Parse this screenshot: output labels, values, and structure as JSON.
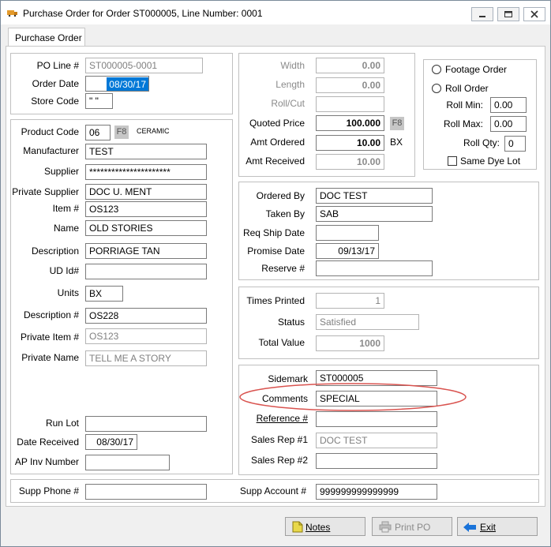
{
  "window": {
    "title": "Purchase Order for Order ST000005, Line Number: 0001"
  },
  "tab": {
    "label": "Purchase Order"
  },
  "header_group": {
    "po_line_label": "PO Line #",
    "po_line_value": "ST000005-0001",
    "order_date_label": "Order Date",
    "order_date_value": "08/30/17",
    "store_code_label": "Store Code",
    "store_code_value": "\" \""
  },
  "product_group": {
    "product_code_label": "Product Code",
    "product_code_value": "06",
    "f8_label": "F8",
    "product_code_desc": "CERAMIC",
    "manufacturer_label": "Manufacturer",
    "manufacturer_value": "TEST",
    "supplier_label": "Supplier",
    "supplier_value": "**********************",
    "private_supplier_label": "Private Supplier",
    "private_supplier_value": "DOC U. MENT",
    "item_label": "Item #",
    "item_value": "OS123",
    "name_label": "Name",
    "name_value": "OLD STORIES",
    "description_label": "Description",
    "description_value": "PORRIAGE TAN",
    "ud_id_label": "UD Id#",
    "ud_id_value": "",
    "units_label": "Units",
    "units_value": "BX",
    "description_no_label": "Description #",
    "description_no_value": "OS228",
    "private_item_label": "Private Item #",
    "private_item_value": "OS123",
    "private_name_label": "Private Name",
    "private_name_value": "TELL ME A STORY",
    "run_lot_label": "Run Lot",
    "run_lot_value": "",
    "date_received_label": "Date Received",
    "date_received_value": "08/30/17",
    "ap_inv_label": "AP Inv Number",
    "ap_inv_value": ""
  },
  "qty_group": {
    "width_label": "Width",
    "width_value": "0.00",
    "length_label": "Length",
    "length_value": "0.00",
    "roll_cut_label": "Roll/Cut",
    "roll_cut_value": "",
    "quoted_price_label": "Quoted Price",
    "quoted_price_value": "100.000",
    "f8_label": "F8",
    "amt_ordered_label": "Amt Ordered",
    "amt_ordered_value": "10.00",
    "amt_ordered_unit": "BX",
    "amt_received_label": "Amt Received",
    "amt_received_value": "10.00"
  },
  "roll_group": {
    "footage_order_label": "Footage Order",
    "roll_order_label": "Roll Order",
    "roll_min_label": "Roll Min:",
    "roll_min_value": "0.00",
    "roll_max_label": "Roll Max:",
    "roll_max_value": "0.00",
    "roll_qty_label": "Roll Qty:",
    "roll_qty_value": "0",
    "same_dye_lot_label": "Same Dye Lot"
  },
  "order_group": {
    "ordered_by_label": "Ordered By",
    "ordered_by_value": "DOC TEST",
    "taken_by_label": "Taken By",
    "taken_by_value": "SAB",
    "req_ship_label": "Req Ship Date",
    "req_ship_value": "",
    "promise_label": "Promise Date",
    "promise_value": "09/13/17",
    "reserve_label": "Reserve #",
    "reserve_value": ""
  },
  "status_group": {
    "times_printed_label": "Times Printed",
    "times_printed_value": "1",
    "status_label": "Status",
    "status_value": "Satisfied",
    "total_value_label": "Total Value",
    "total_value_value": "1000"
  },
  "misc_group": {
    "sidemark_label": "Sidemark",
    "sidemark_value": "ST000005",
    "comments_label": "Comments",
    "comments_value": "SPECIAL",
    "reference_label": "Reference #",
    "reference_value": "",
    "sales_rep1_label": "Sales Rep #1",
    "sales_rep1_value": "DOC TEST",
    "sales_rep2_label": "Sales Rep #2",
    "sales_rep2_value": ""
  },
  "footer_group": {
    "supp_phone_label": "Supp Phone #",
    "supp_phone_value": "",
    "supp_account_label": "Supp Account #",
    "supp_account_value": "999999999999999"
  },
  "buttons": {
    "notes": "Notes",
    "print_po": "Print PO",
    "exit": "Exit"
  },
  "colors": {
    "annotation": "#d9534f",
    "selection": "#0078d7",
    "exit_arrow": "#1a73d9",
    "notes_icon": "#e8d84a"
  }
}
